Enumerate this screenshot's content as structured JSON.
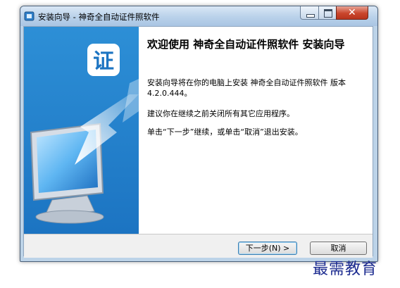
{
  "window": {
    "title": "安装向导 - 神奇全自动证件照软件",
    "app_icon": "installer-icon"
  },
  "banner": {
    "badge_text": "证",
    "illustration": "monitor-illustration"
  },
  "content": {
    "heading": "欢迎使用 神奇全自动证件照软件 安装向导",
    "paragraph_1": "安装向导将在你的电脑上安装 神奇全自动证件照软件 版本 4.2.0.444。",
    "paragraph_2": "建议你在继续之前关闭所有其它应用程序。",
    "paragraph_3": "单击“下一步”继续，或单击“取消”退出安装。"
  },
  "buttons": {
    "next_label": "下一步(N) >",
    "cancel_label": "取消"
  },
  "watermark": "最需教育",
  "colors": {
    "banner_blue": "#1c74c2",
    "close_red": "#c9462c",
    "watermark_blue": "#1b2a8f"
  }
}
